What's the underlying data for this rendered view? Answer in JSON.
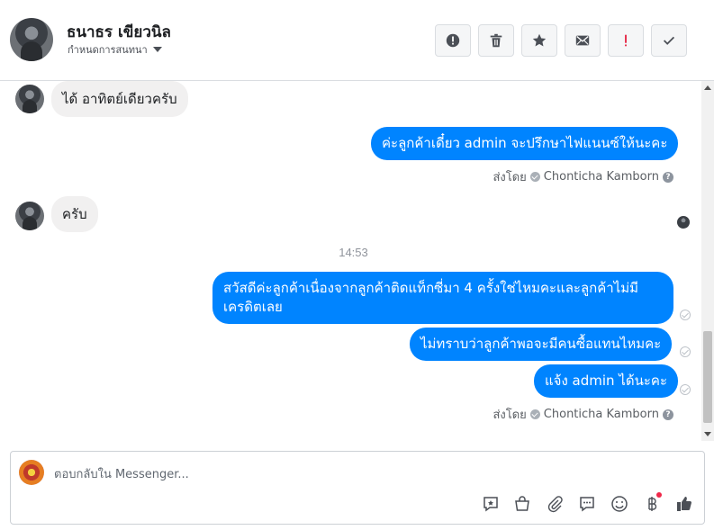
{
  "header": {
    "name": "ธนาธร เขียวนิล",
    "subtitle": "กำหนดการสนทนา",
    "actions": [
      {
        "icon": "alert-circle-icon",
        "label": "spam"
      },
      {
        "icon": "trash-icon",
        "label": "delete"
      },
      {
        "icon": "star-icon",
        "label": "follow-up"
      },
      {
        "icon": "envelope-icon",
        "label": "mark-unread"
      },
      {
        "icon": "exclamation-icon",
        "label": "priority"
      },
      {
        "icon": "checkmark-icon",
        "label": "done"
      }
    ]
  },
  "messages": [
    {
      "from": "contact",
      "text": "ได้ อาทิตย์เดียวครับ"
    },
    {
      "from": "page",
      "text": "ค่ะลูกค้าเดี๋ยว admin จะปรึกษาไฟแนนซ์ให้นะคะ"
    },
    {
      "from": "contact",
      "text": "ครับ"
    },
    {
      "from": "page",
      "text": "สวัสดีค่ะลูกค้าเนื่องจากลูกค้าติดแท็กซี่มา 4 ครั้งใช่ไหมคะและลูกค้าไม่มีเครดิตเลย"
    },
    {
      "from": "page",
      "text": "ไม่ทราบว่าลูกค้าพอจะมีคนซื้อแทนไหมคะ"
    },
    {
      "from": "page",
      "text": "แจ้ง admin ได้นะคะ"
    }
  ],
  "sent_by_label": "ส่งโดย",
  "sent_by_name": "Chonticha Kamborn",
  "timestamp": "14:53",
  "composer": {
    "placeholder": "ตอบกลับใน Messenger...",
    "tools": [
      "reply-icon",
      "shopping-bag-icon",
      "paperclip-icon",
      "chat-bubble-icon",
      "emoji-icon",
      "baht-payment-icon",
      "thumbs-up-icon"
    ]
  },
  "colors": {
    "accent": "#0084ff",
    "incoming_bubble": "#f1f0f0",
    "badge_red": "#f02849"
  }
}
